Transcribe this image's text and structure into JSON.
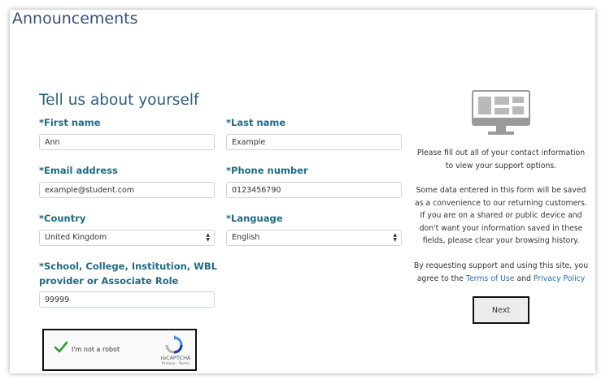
{
  "page": {
    "heading": "Announcements"
  },
  "form": {
    "title": "Tell us about yourself",
    "first_name": {
      "label": "*First name",
      "value": "Ann"
    },
    "last_name": {
      "label": "*Last name",
      "value": "Example"
    },
    "email": {
      "label": "*Email address",
      "value": "example@student.com"
    },
    "phone": {
      "label": "*Phone number",
      "value": "0123456790"
    },
    "country": {
      "label": "*Country",
      "value": "United Kingdom"
    },
    "language": {
      "label": "*Language",
      "value": "English"
    },
    "institution": {
      "label_line1": "*School, College, Institution, WBL",
      "label_line2": "provider or Associate Role",
      "value": "99999"
    }
  },
  "captcha": {
    "label": "I'm not a robot",
    "brand": "reCAPTCHA",
    "footer": "Privacy - Terms",
    "icons": {
      "check": "checkmark-icon",
      "logo": "recaptcha-logo-icon"
    }
  },
  "info": {
    "icon": "monitor-icon",
    "p1": "Please fill out all of your contact information to view your support options.",
    "p2": "Some data entered in this form will be saved as a convenience to our returning customers. If you are on a shared or public device and don't want your information saved in these fields, please clear your browsing history.",
    "p3_prefix": "By requesting support and using this site, you agree to the",
    "terms_link": "Terms of Use",
    "p3_and": "and",
    "privacy_link": "Privacy Policy",
    "next_button": "Next"
  },
  "colors": {
    "heading": "#3a4f77",
    "label": "#1f6b82",
    "link": "#2a6db8",
    "check": "#2e9b3a"
  }
}
